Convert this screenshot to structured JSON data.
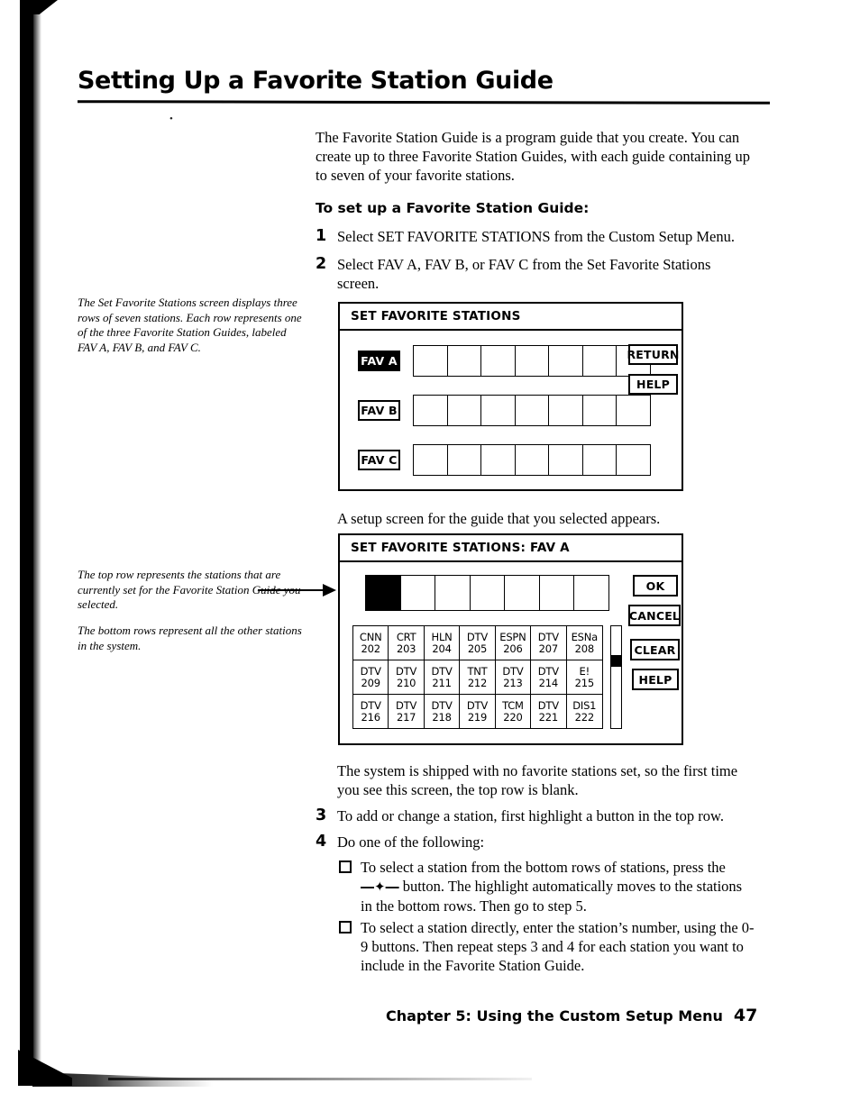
{
  "page": {
    "title": "Setting Up a Favorite Station Guide",
    "footer_text": "Chapter 5: Using the Custom Setup Menu",
    "page_number": "47",
    "speck": "•"
  },
  "intro": "The Favorite Station Guide is a program guide that you create. You can create up to three Favorite Station Guides, with each guide containing up to seven of your favorite stations.",
  "subhead": "To set up a Favorite Station Guide:",
  "steps": [
    {
      "num": "1",
      "text": "Select SET FAVORITE STATIONS from the Custom Setup Menu."
    },
    {
      "num": "2",
      "text": "Select FAV A, FAV B, or FAV C from the Set Favorite Stations screen."
    },
    {
      "num": "3",
      "text": "To add or change a station, first highlight a button in the top row."
    },
    {
      "num": "4",
      "text": "Do one of the following:"
    }
  ],
  "notes": {
    "note1": "The Set Favorite Stations screen displays three rows of seven stations. Each row represents one of the three Favorite Station Guides, labeled FAV A, FAV B, and FAV C.",
    "note2": "The top row represents the stations that are currently set for the Favorite Station Guide you selected.",
    "note3": "The bottom rows represent all the other stations in the system."
  },
  "paragraphs": {
    "after_fig1": "A setup screen for the guide that you selected appears.",
    "after_fig2": "The system is shipped with no favorite stations set, so the first time you see this screen, the top row is blank."
  },
  "bullets": [
    {
      "part1": "To select a station from the bottom rows of stations, press the",
      "glyph": "―✦―",
      "part2": "button. The highlight automatically moves to the stations in the bottom rows. Then go to step 5."
    },
    {
      "part1": "To select a station directly, enter the station’s number, using the 0-9 buttons. Then repeat steps 3 and 4 for each station you want to include in the Favorite Station Guide.",
      "glyph": "",
      "part2": ""
    }
  ],
  "figure1": {
    "title": "SET FAVORITE STATIONS",
    "rows": [
      {
        "label": "FAV A",
        "selected": true,
        "slot_count": 7
      },
      {
        "label": "FAV B",
        "selected": false,
        "slot_count": 7
      },
      {
        "label": "FAV C",
        "selected": false,
        "slot_count": 7
      }
    ],
    "buttons": [
      "RETURN",
      "HELP"
    ]
  },
  "figure2": {
    "title": "SET FAVORITE STATIONS: FAV A",
    "top_row": {
      "slot_count": 7,
      "filled_index": 0
    },
    "buttons": [
      "OK",
      "CANCEL",
      "CLEAR",
      "HELP"
    ],
    "station_grid": [
      {
        "name": "CNN",
        "number": "202"
      },
      {
        "name": "CRT",
        "number": "203"
      },
      {
        "name": "HLN",
        "number": "204"
      },
      {
        "name": "DTV",
        "number": "205"
      },
      {
        "name": "ESPN",
        "number": "206"
      },
      {
        "name": "DTV",
        "number": "207"
      },
      {
        "name": "ESNa",
        "number": "208"
      },
      {
        "name": "DTV",
        "number": "209"
      },
      {
        "name": "DTV",
        "number": "210"
      },
      {
        "name": "DTV",
        "number": "211"
      },
      {
        "name": "TNT",
        "number": "212"
      },
      {
        "name": "DTV",
        "number": "213"
      },
      {
        "name": "DTV",
        "number": "214"
      },
      {
        "name": "E!",
        "number": "215"
      },
      {
        "name": "DTV",
        "number": "216"
      },
      {
        "name": "DTV",
        "number": "217"
      },
      {
        "name": "DTV",
        "number": "218"
      },
      {
        "name": "DTV",
        "number": "219"
      },
      {
        "name": "TCM",
        "number": "220"
      },
      {
        "name": "DTV",
        "number": "221"
      },
      {
        "name": "DIS1",
        "number": "222"
      }
    ],
    "scrollbar": {
      "thumb_position_percent": 33
    }
  }
}
